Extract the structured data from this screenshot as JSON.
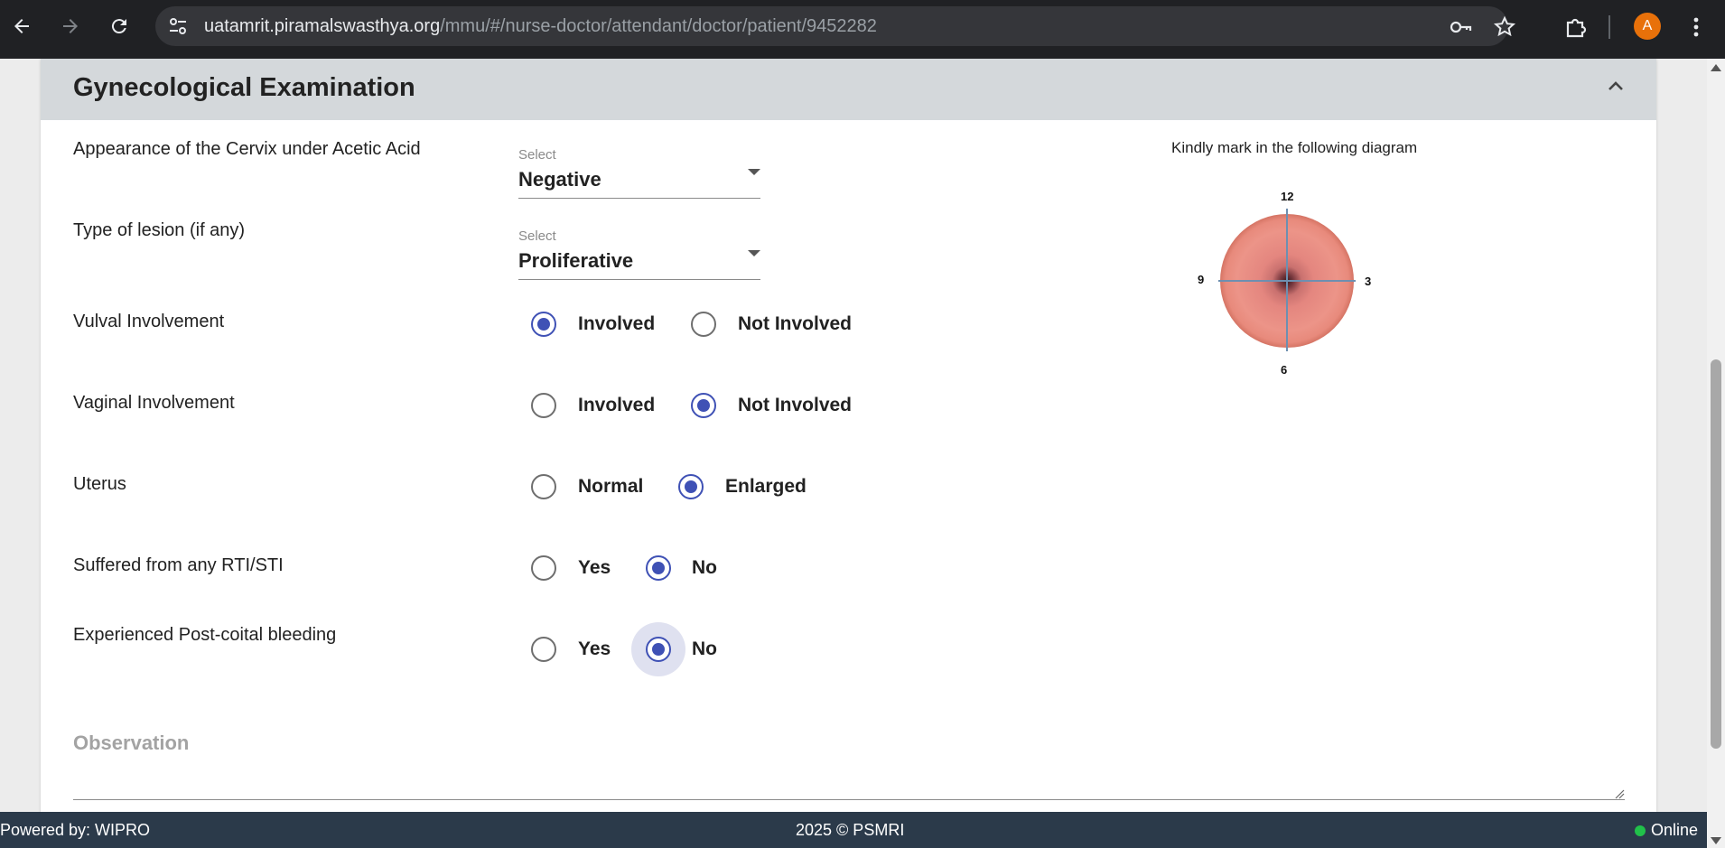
{
  "browser": {
    "url_host": "uatamrit.piramalswasthya.org",
    "url_path": "/mmu/#/nurse-doctor/attendant/doctor/patient/9452282",
    "profile_initial": "A",
    "icons": [
      "back-arrow-icon",
      "forward-arrow-icon",
      "reload-icon",
      "site-info-icon",
      "password-key-icon",
      "bookmark-star-icon",
      "extensions-icon",
      "menu-kebab-icon"
    ]
  },
  "section": {
    "title": "Gynecological Examination"
  },
  "fields": {
    "cervix_label": "Appearance of the Cervix under Acetic Acid",
    "cervix_caption": "Select",
    "cervix_value": "Negative",
    "lesion_label": "Type of lesion (if any)",
    "lesion_caption": "Select",
    "lesion_value": "Proliferative",
    "vulval_label": "Vulval Involvement",
    "vulval_opt1": "Involved",
    "vulval_opt2": "Not Involved",
    "vulval_selected": "Involved",
    "vaginal_label": "Vaginal Involvement",
    "vaginal_opt1": "Involved",
    "vaginal_opt2": "Not Involved",
    "vaginal_selected": "Not Involved",
    "uterus_label": "Uterus",
    "uterus_opt1": "Normal",
    "uterus_opt2": "Enlarged",
    "uterus_selected": "Enlarged",
    "rti_label": "Suffered from any RTI/STI",
    "rti_opt1": "Yes",
    "rti_opt2": "No",
    "rti_selected": "No",
    "pcb_label": "Experienced Post-coital bleeding",
    "pcb_opt1": "Yes",
    "pcb_opt2": "No",
    "pcb_selected": "No",
    "observation_label": "Observation"
  },
  "diagram": {
    "caption": "Kindly mark in the following diagram",
    "top": "12",
    "right": "3",
    "bottom": "6",
    "left": "9"
  },
  "footer": {
    "left": "Powered by: WIPRO",
    "center": "2025 © PSMRI",
    "right": "Online"
  },
  "colors": {
    "accent": "#3f51b5",
    "header_bg": "#d4d8db",
    "footer_bg": "#2b3a4a",
    "online": "#21c14a"
  }
}
